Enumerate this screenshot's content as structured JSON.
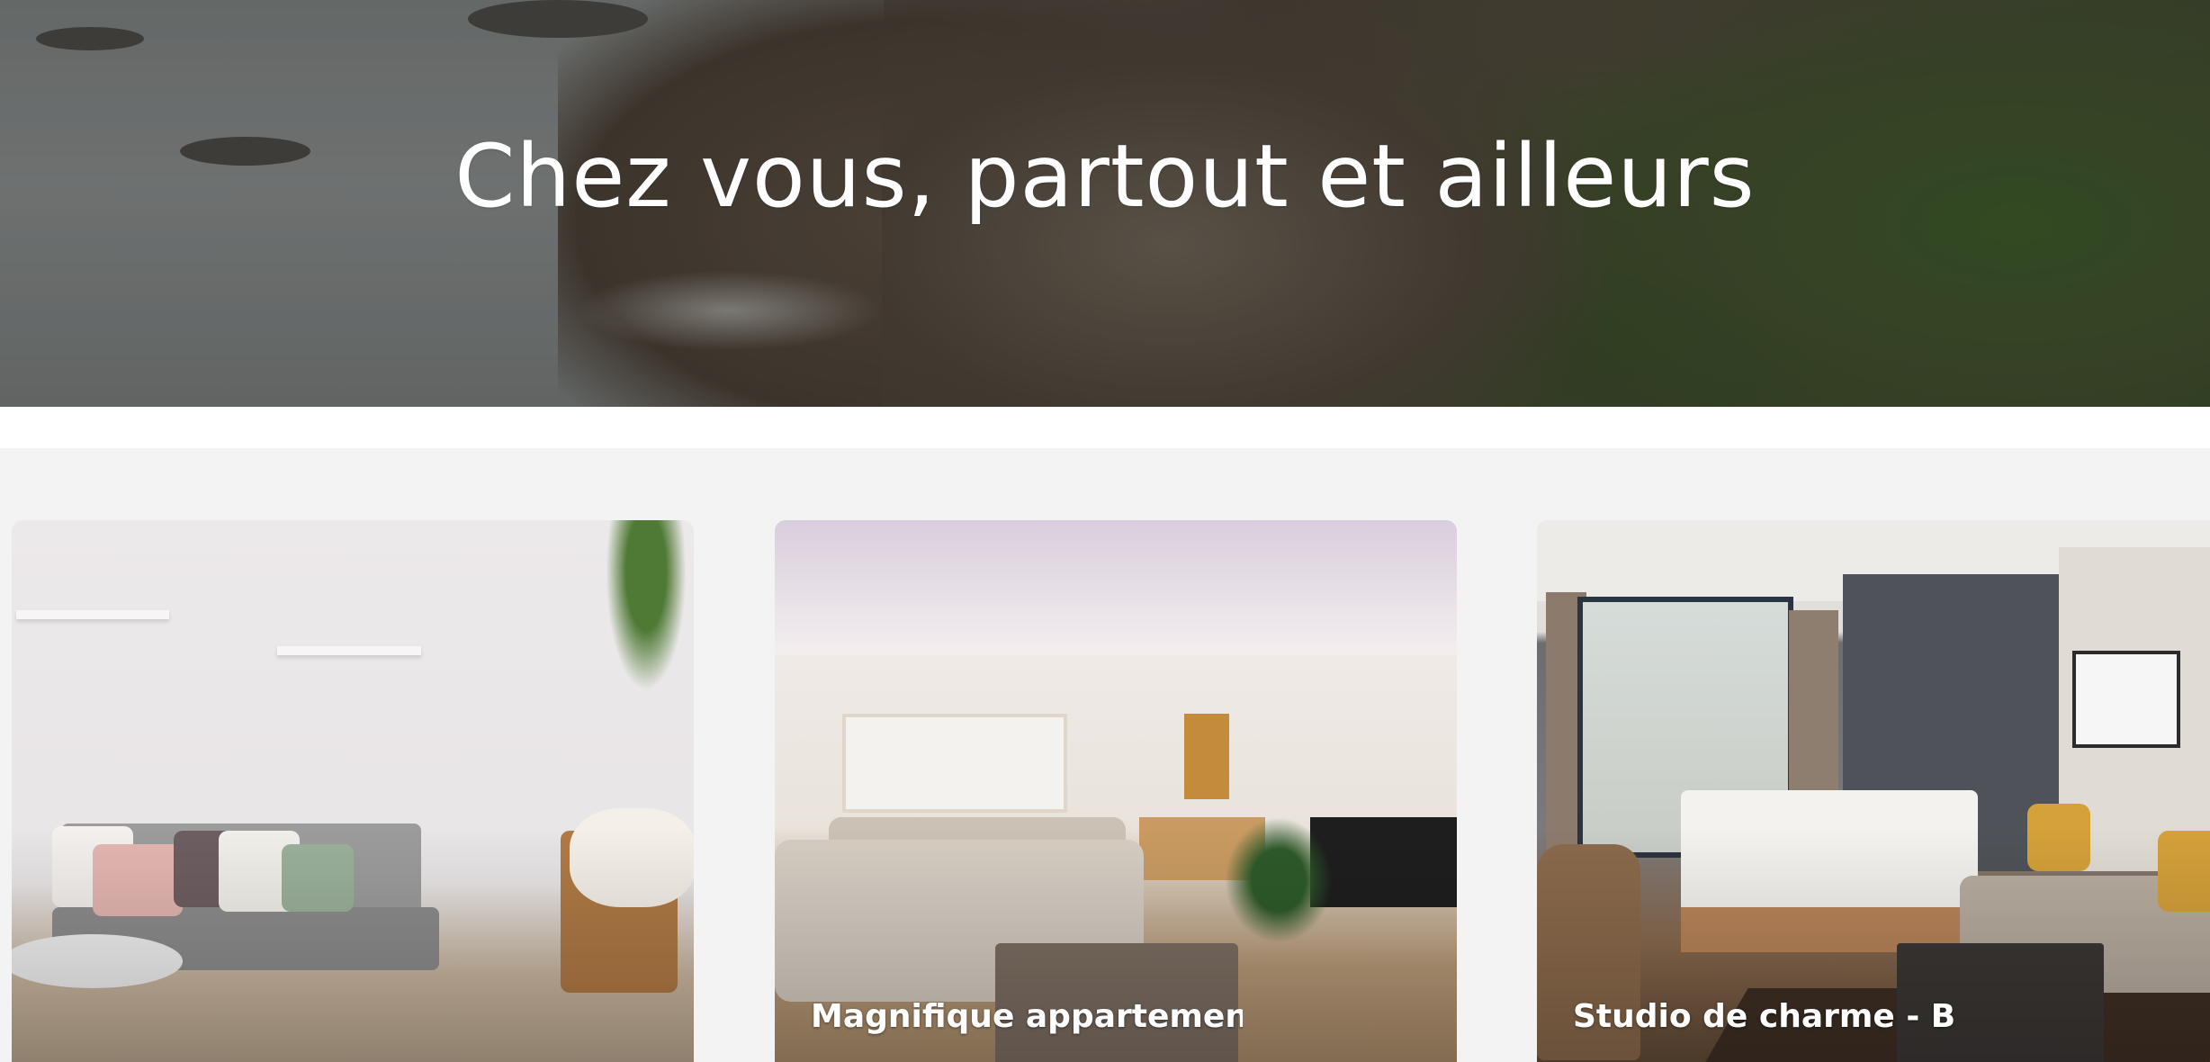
{
  "hero": {
    "title": "Chez vous, partout et ailleurs"
  },
  "listings": [
    {
      "title": "",
      "photo": "living-room-scandinavian"
    },
    {
      "title": "Magnifique appartement",
      "photo": "living-room-open-plan"
    },
    {
      "title": "Studio de charme - B",
      "photo": "hotel-bedroom-studio"
    }
  ],
  "colors": {
    "card_background": "#f3f3f3",
    "band": "#ffffff",
    "hero_text": "#ffffff"
  }
}
